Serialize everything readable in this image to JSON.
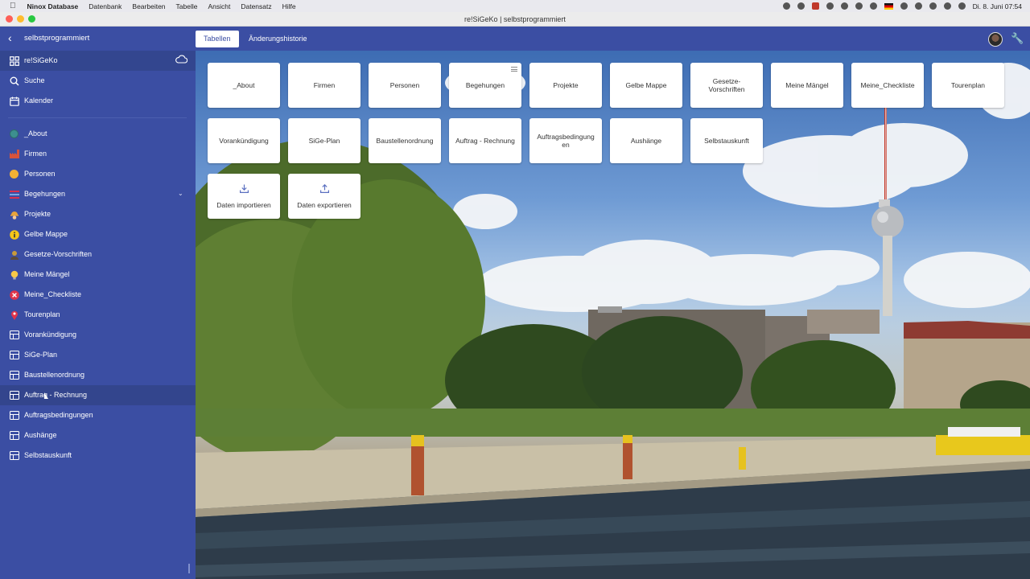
{
  "menubar": {
    "app_name": "Ninox Database",
    "items": [
      "Datenbank",
      "Bearbeiten",
      "Tabelle",
      "Ansicht",
      "Datensatz",
      "Hilfe"
    ],
    "clock": "Di. 8. Juni  07:54"
  },
  "window": {
    "title": "re!SiGeKo | selbstprogrammiert"
  },
  "header": {
    "back_label": "selbstprogrammiert",
    "tabs": [
      "Tabellen",
      "Änderungshistorie"
    ]
  },
  "sidebar": {
    "top": [
      {
        "label": "re!SiGeKo",
        "icon": "grid-icon"
      },
      {
        "label": "Suche",
        "icon": "search-icon"
      },
      {
        "label": "Kalender",
        "icon": "calendar-icon"
      }
    ],
    "tables": [
      {
        "label": "_About",
        "icon": "globe-icon",
        "color": "#3d8f8f"
      },
      {
        "label": "Firmen",
        "icon": "factory-icon",
        "color": "#d9533b"
      },
      {
        "label": "Personen",
        "icon": "person-icon",
        "color": "#f2b134"
      },
      {
        "label": "Begehungen",
        "icon": "list-icon",
        "color": "#d8304f"
      },
      {
        "label": "Projekte",
        "icon": "worker-icon",
        "color": "#e8a33a"
      },
      {
        "label": "Gelbe Mappe",
        "icon": "info-icon",
        "color": "#f5c518"
      },
      {
        "label": "Gesetze-Vorschriften",
        "icon": "judge-icon",
        "color": "#c89a3a"
      },
      {
        "label": "Meine Mängel",
        "icon": "bulb-icon",
        "color": "#f7c948"
      },
      {
        "label": "Meine_Checkliste",
        "icon": "cross-icon",
        "color": "#e0344a"
      },
      {
        "label": "Tourenplan",
        "icon": "pin-icon",
        "color": "#e0344a"
      },
      {
        "label": "Vorankündigung",
        "icon": "table-icon"
      },
      {
        "label": "SiGe-Plan",
        "icon": "table-icon"
      },
      {
        "label": "Baustellenordnung",
        "icon": "table-icon"
      },
      {
        "label": "Auftrag - Rechnung",
        "icon": "table-icon"
      },
      {
        "label": "Auftragsbedingungen",
        "icon": "table-icon"
      },
      {
        "label": "Aushänge",
        "icon": "table-icon"
      },
      {
        "label": "Selbstauskunft",
        "icon": "table-icon"
      }
    ]
  },
  "tiles": [
    "_About",
    "Firmen",
    "Personen",
    "Begehungen",
    "Projekte",
    "Gelbe Mappe",
    "Gesetze-Vorschriften",
    "Meine Mängel",
    "Meine_Checkliste",
    "Tourenplan",
    "Vorankündigung",
    "SiGe-Plan",
    "Baustellenordnung",
    "Auftrag - Rechnung",
    "Auftragsbedingungen",
    "Aushänge",
    "Selbstauskunft"
  ],
  "actions": [
    {
      "label": "Daten importieren",
      "icon": "download-icon"
    },
    {
      "label": "Daten exportieren",
      "icon": "upload-icon"
    }
  ],
  "colors": {
    "sidebar_bg": "#3b4ea3",
    "accent": "#3b4ea3"
  }
}
